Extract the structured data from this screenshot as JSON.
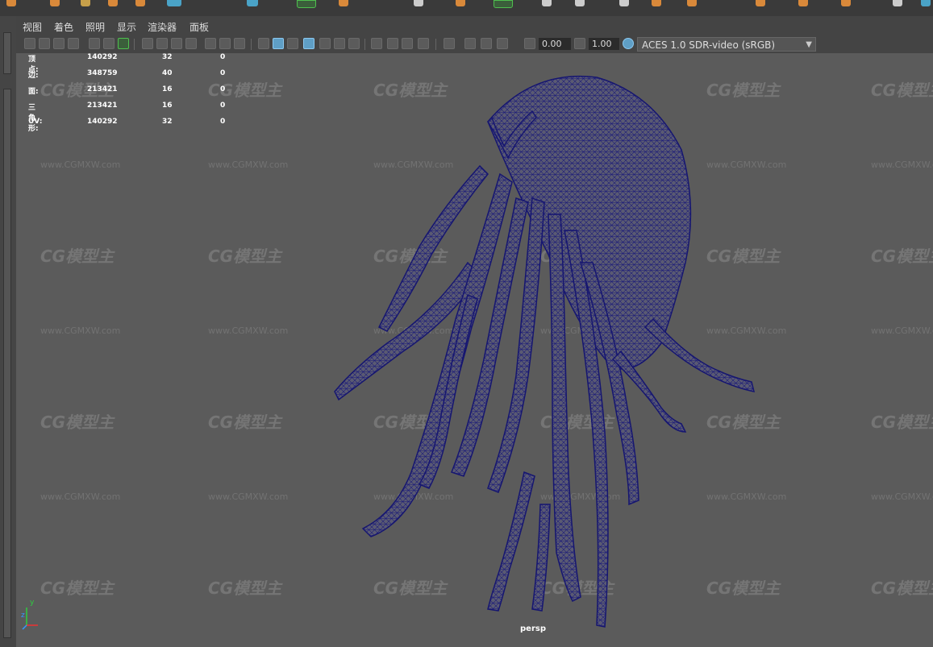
{
  "menu": [
    "视图",
    "着色",
    "照明",
    "显示",
    "渲染器",
    "面板"
  ],
  "toolbar": {
    "exposure": "0.00",
    "gamma": "1.00",
    "colorspace": "ACES 1.0 SDR-video (sRGB)"
  },
  "hud": {
    "rows": [
      {
        "label": "顶点:",
        "v1": "140292",
        "v2": "32",
        "v3": "0"
      },
      {
        "label": "边:",
        "v1": "348759",
        "v2": "40",
        "v3": "0"
      },
      {
        "label": "面:",
        "v1": "213421",
        "v2": "16",
        "v3": "0"
      },
      {
        "label": "三角形:",
        "v1": "213421",
        "v2": "16",
        "v3": "0"
      },
      {
        "label": "UV:",
        "v1": "140292",
        "v2": "32",
        "v3": "0"
      }
    ]
  },
  "camera": "persp",
  "axis": {
    "x": "x",
    "y": "y",
    "z": "z"
  },
  "watermark": {
    "logo": "CG模型主",
    "url": "www.CGMXW.com"
  },
  "colors": {
    "wireframe": "#1a1a7a",
    "viewport_bg": "#5b5b5b",
    "accent": "#5f9fc6"
  }
}
